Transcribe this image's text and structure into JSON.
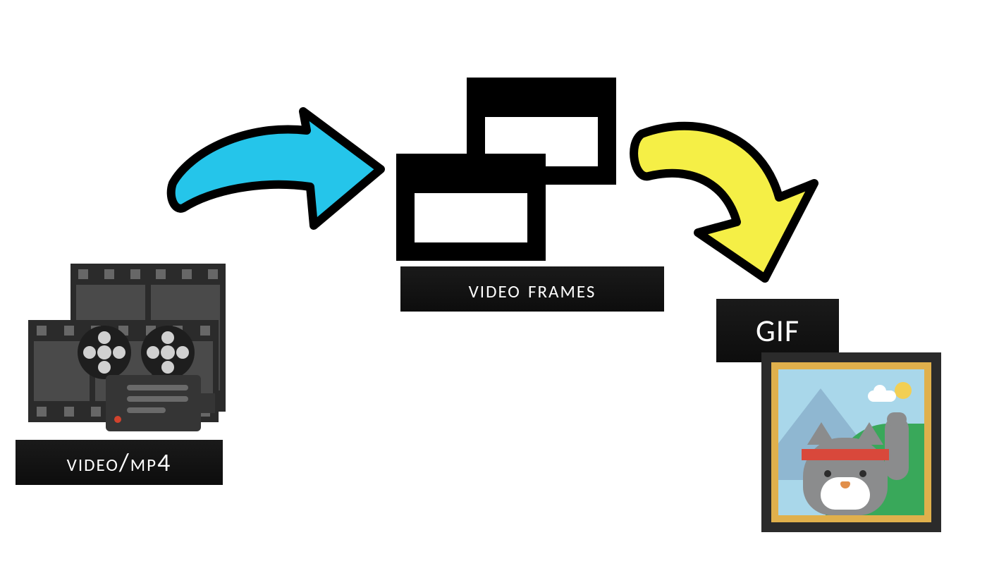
{
  "diagram": {
    "stage1": {
      "label": "video/mp4",
      "icon_name": "film-projector-icon"
    },
    "arrow1": {
      "name": "arrow-right-blue",
      "fill": "#25c5ea",
      "stroke": "#000000"
    },
    "stage2": {
      "label": "video frames",
      "icon_name": "stacked-windows-icon"
    },
    "arrow2": {
      "name": "arrow-curved-down-yellow",
      "fill": "#f5ef46",
      "stroke": "#000000"
    },
    "stage3": {
      "label": "GIF",
      "icon_name": "framed-picture-icon"
    }
  }
}
